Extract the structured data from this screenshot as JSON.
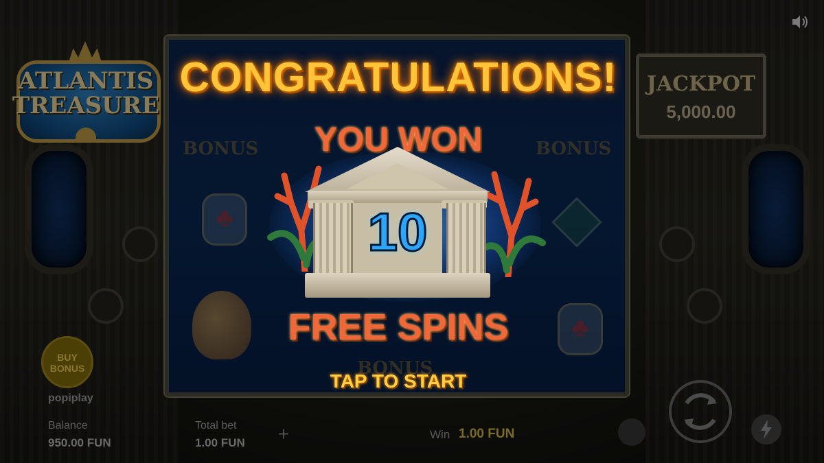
{
  "logo": {
    "line1": "ATLANTIS",
    "line2": "TREASURE"
  },
  "jackpot": {
    "label": "JACKPOT",
    "value": "5,000.00"
  },
  "reels": {
    "bonus_symbol": "BONUS"
  },
  "popup": {
    "title": "CONGRATULATIONS!",
    "subtitle": "YOU WON",
    "spins_count": "10",
    "spins_label": "FREE SPINS",
    "cta": "TAP TO START"
  },
  "buy_bonus": {
    "label_line1": "BUY",
    "label_line2": "BONUS"
  },
  "provider": "popiplay",
  "footer": {
    "balance_label": "Balance",
    "balance_value": "950.00 FUN",
    "total_bet_label": "Total bet",
    "total_bet_value": "1.00 FUN",
    "win_label": "Win",
    "win_value": "1.00 FUN"
  },
  "icons": {
    "sound": "speaker-icon",
    "spin": "spin-arrows-icon",
    "turbo": "lightning-icon",
    "plus": "plus-icon"
  },
  "colors": {
    "title_gold": "#ffc43a",
    "won_orange": "#f0673a",
    "number_blue": "#2aa6ff",
    "cta_yellow": "#ffd046"
  }
}
